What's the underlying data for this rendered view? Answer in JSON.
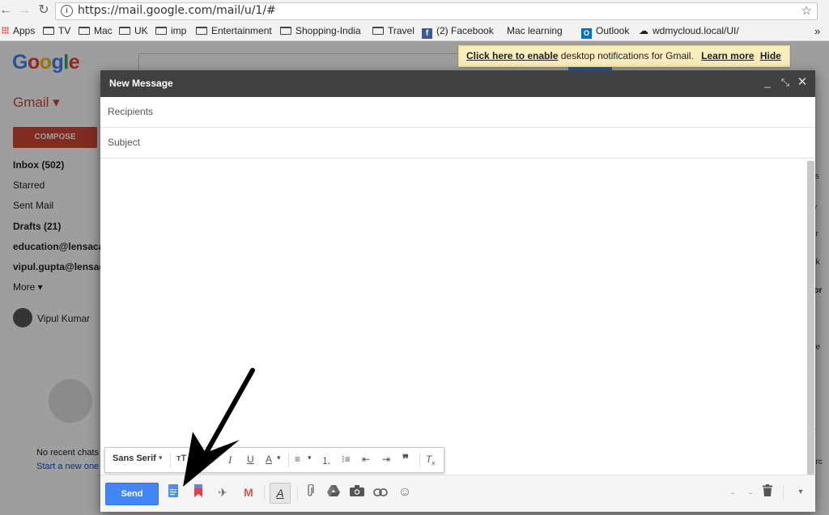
{
  "browser": {
    "url": "https://mail.google.com/mail/u/1/#",
    "bookmarks": [
      "Apps",
      "TV",
      "Mac",
      "UK",
      "imp",
      "Entertainment",
      "Shopping-India",
      "Travel",
      "(2) Facebook",
      "Mac learning",
      "Outlook",
      "wdmycloud.local/UI/"
    ],
    "more": "»"
  },
  "gmail": {
    "logo": "Google",
    "label": "Gmail ▾",
    "compose": "COMPOSE",
    "nav": [
      "Inbox (502)",
      "Starred",
      "Sent Mail",
      "Drafts (21)",
      "education@lensaca",
      "vipul.gupta@lensac",
      "More ▾"
    ],
    "user": "Vipul Kumar",
    "hangouts_empty": "No recent chats",
    "hangouts_link": "Start a new one",
    "notification": {
      "link": "Click here to enable",
      "text": "desktop notifications for Gmail.",
      "learn_more": "Learn more",
      "hide": "Hide"
    },
    "right_fragments": [
      "ss",
      "ly",
      "ur",
      "nk",
      "for",
      "e",
      "ire",
      "y",
      "<",
      "erc"
    ]
  },
  "compose": {
    "title": "New Message",
    "recipients_placeholder": "Recipients",
    "subject_placeholder": "Subject",
    "send": "Send",
    "font": "Sans Serif",
    "colors": {
      "send": "#4285f4",
      "header": "#404040",
      "gmail_red": "#d14836"
    }
  }
}
